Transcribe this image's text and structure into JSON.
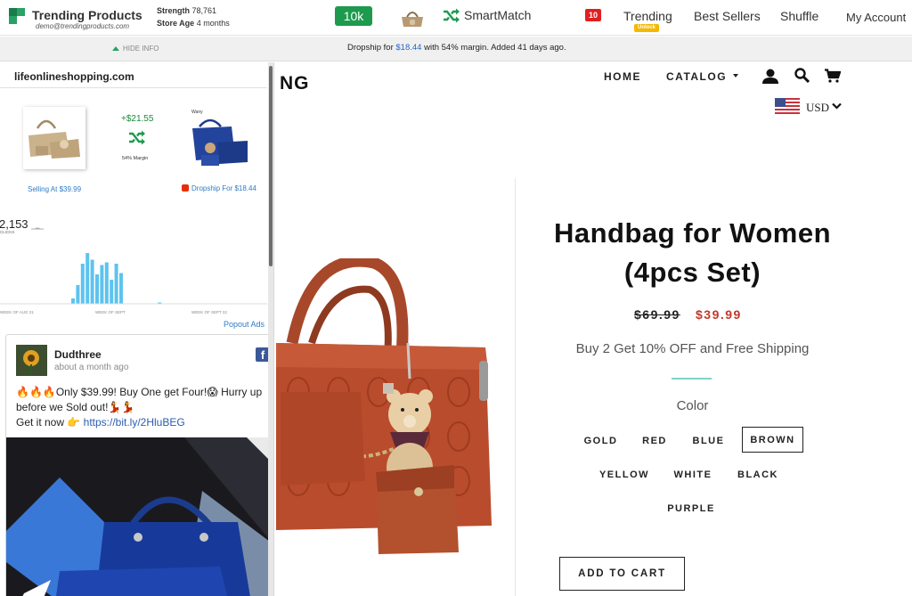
{
  "toolbar": {
    "brand": "Trending Products",
    "email": "demo@trendingproducts.com",
    "strength_label": "Strength",
    "strength_value": "78,761",
    "store_age_label": "Store Age",
    "store_age_value": "4 months",
    "volume_badge": "10k",
    "smartmatch_label": "SmartMatch",
    "notification_count": "10",
    "trending_label": "Trending",
    "unlock_label": "Unlock",
    "best_sellers_label": "Best Sellers",
    "shuffle_label": "Shuffle",
    "account_label": "My Account",
    "accent_color": "#1e9a4e"
  },
  "info_strip": {
    "hide_info_label": "HIDE INFO",
    "text_prefix": "Dropship for ",
    "dropship_price": "$18.44",
    "text_suffix": " with 54% margin. Added 41 days ago."
  },
  "panel": {
    "store_domain": "lifeonlineshopping.com",
    "margin_amount": "+$21.55",
    "margin_percent": "54% Margin",
    "supplier_brand": "Wany",
    "selling_at": "Selling At $39.99",
    "dropship_for": "Dropship For $18.44",
    "clicks_value": "2,153",
    "clicks_label": "CLICKS",
    "popout_label": "Popout Ads",
    "chart_data": {
      "type": "bar",
      "title": "",
      "xlabel": "",
      "ylabel": "",
      "x_tick_labels": [
        "WEEK OF AUG 21",
        "WEEK OF SEPT",
        "WEEK OF SEPT 22"
      ],
      "values": [
        4,
        14,
        30,
        38,
        33,
        22,
        29,
        31,
        18,
        30,
        23,
        0,
        0,
        0,
        0,
        0,
        0,
        0,
        1,
        0
      ],
      "ylim": [
        0,
        40
      ],
      "bar_color": "#5ec3ee",
      "grid": false
    },
    "ad": {
      "page_name": "Dudthree",
      "posted_time": "about a month ago",
      "line1": "🔥🔥🔥Only $39.99! Buy One get Four!😱 Hurry up before we Sold out!💃💃",
      "line2_prefix": "Get it now 👉 ",
      "link": "https://bit.ly/2HluBEG"
    }
  },
  "store": {
    "logo_text": "NG",
    "nav": {
      "home": "HOME",
      "catalog": "CATALOG"
    },
    "currency": "USD",
    "product": {
      "title": "Handbag for Women (4pcs Set)",
      "compare_price": "$69.99",
      "sale_price": "$39.99",
      "promo": "Buy 2 Get 10% OFF and Free Shipping",
      "color_label": "Color",
      "colors": [
        "GOLD",
        "RED",
        "BLUE",
        "BROWN",
        "YELLOW",
        "WHITE",
        "BLACK",
        "PURPLE"
      ],
      "selected_color": "BROWN",
      "add_to_cart": "ADD TO CART",
      "sale_color": "#c0392b"
    }
  }
}
